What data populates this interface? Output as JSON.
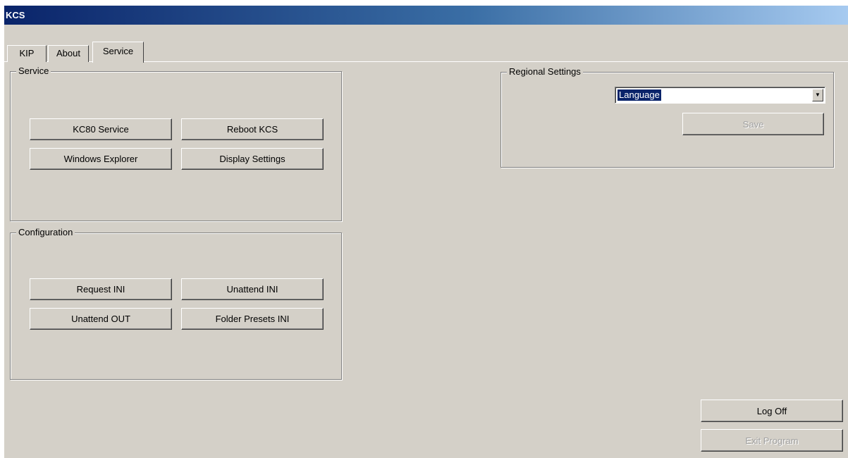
{
  "window": {
    "title": "KCS"
  },
  "tabs": [
    {
      "label": "KIP"
    },
    {
      "label": "About"
    },
    {
      "label": "Service"
    }
  ],
  "service_group": {
    "label": "Service",
    "buttons": [
      "KC80 Service",
      "Reboot KCS",
      "Windows Explorer",
      "Display Settings"
    ]
  },
  "config_group": {
    "label": "Configuration",
    "buttons": [
      "Request INI",
      "Unattend INI",
      "Unattend OUT",
      "Folder Presets INI"
    ]
  },
  "regional": {
    "label": "Regional Settings",
    "language_value": "Language",
    "save_label": "Save",
    "arrow_icon": "chevron-down-icon"
  },
  "footer": {
    "log_off_label": "Log Off",
    "exit_label": "Exit Program"
  }
}
